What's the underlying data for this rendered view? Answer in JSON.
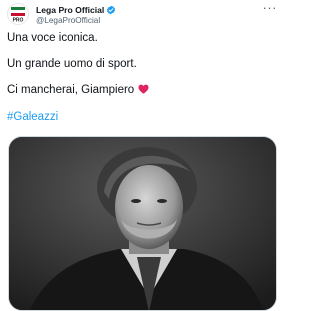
{
  "tweet": {
    "author": {
      "display_name": "Lega Pro Official",
      "handle": "@LegaProOfficial",
      "verified": true,
      "avatar_icon": "lega-pro-logo-icon"
    },
    "more_icon": "more-options-icon",
    "lines": [
      "Una voce iconica.",
      "Un grande uomo di sport.",
      "Ci mancherai, Giampiero"
    ],
    "hashtag": "#Galeazzi",
    "colors": {
      "heart": "#e0245e",
      "verified": "#1d9bf0",
      "hashtag": "#1d9bf0"
    }
  }
}
